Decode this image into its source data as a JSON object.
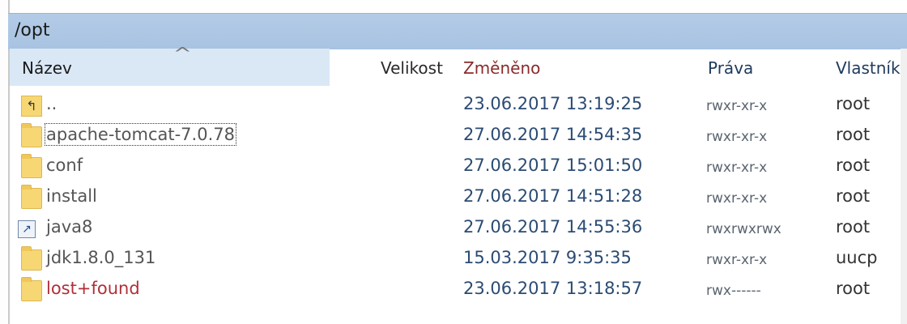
{
  "path": "/opt",
  "columns": {
    "name": "Název",
    "size": "Velikost",
    "modified": "Změněno",
    "rights": "Práva",
    "owner": "Vlastník"
  },
  "icons": {
    "sort": "chevron-up-icon",
    "parent": "parent-folder-icon",
    "folder": "folder-icon",
    "symlink": "shortcut-icon"
  },
  "rows": [
    {
      "name": "..",
      "modified": "23.06.2017 13:19:25",
      "rights": "rwxr-xr-x",
      "owner": "root"
    },
    {
      "name": "apache-tomcat-7.0.78",
      "modified": "27.06.2017 14:54:35",
      "rights": "rwxr-xr-x",
      "owner": "root"
    },
    {
      "name": "conf",
      "modified": "27.06.2017 15:01:50",
      "rights": "rwxr-xr-x",
      "owner": "root"
    },
    {
      "name": "install",
      "modified": "27.06.2017 14:51:28",
      "rights": "rwxr-xr-x",
      "owner": "root"
    },
    {
      "name": "java8",
      "modified": "27.06.2017 14:55:36",
      "rights": "rwxrwxrwx",
      "owner": "root"
    },
    {
      "name": "jdk1.8.0_131",
      "modified": "15.03.2017 9:35:35",
      "rights": "rwxr-xr-x",
      "owner": "uucp"
    },
    {
      "name": "lost+found",
      "modified": "23.06.2017 13:18:57",
      "rights": "rwx------",
      "owner": "root"
    }
  ]
}
